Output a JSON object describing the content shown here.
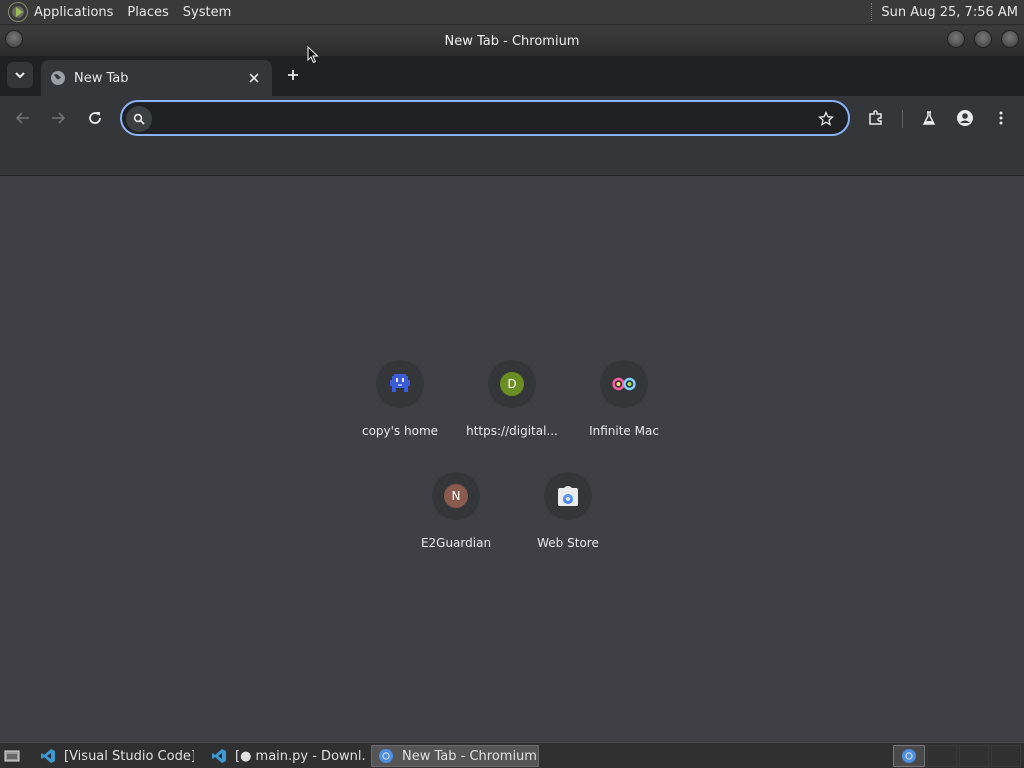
{
  "panel": {
    "menus": [
      "Applications",
      "Places",
      "System"
    ],
    "clock": "Sun Aug 25,  7:56 AM"
  },
  "window": {
    "title": "New Tab - Chromium"
  },
  "tab": {
    "label": "New Tab"
  },
  "omnibox": {
    "value": "",
    "placeholder": ""
  },
  "colors": {
    "accent": "#8ab4f8",
    "tab_bg": "#35363a",
    "ntp_bg": "#3f3f45"
  },
  "shortcuts": [
    {
      "label": "copy's home",
      "icon": "pixel-monster-icon"
    },
    {
      "label": "https://digital...",
      "icon": "letter-d-icon",
      "letter": "D",
      "color": "#6b8e23"
    },
    {
      "label": "Infinite Mac",
      "icon": "infinity-icon"
    },
    {
      "label": "E2Guardian",
      "icon": "letter-n-icon",
      "letter": "N",
      "color": "#8a5a4e"
    },
    {
      "label": "Web Store",
      "icon": "web-store-icon"
    }
  ],
  "taskbar": {
    "items": [
      "[Visual Studio Code]",
      "[● main.py - Downl...",
      "New Tab - Chromium"
    ]
  }
}
